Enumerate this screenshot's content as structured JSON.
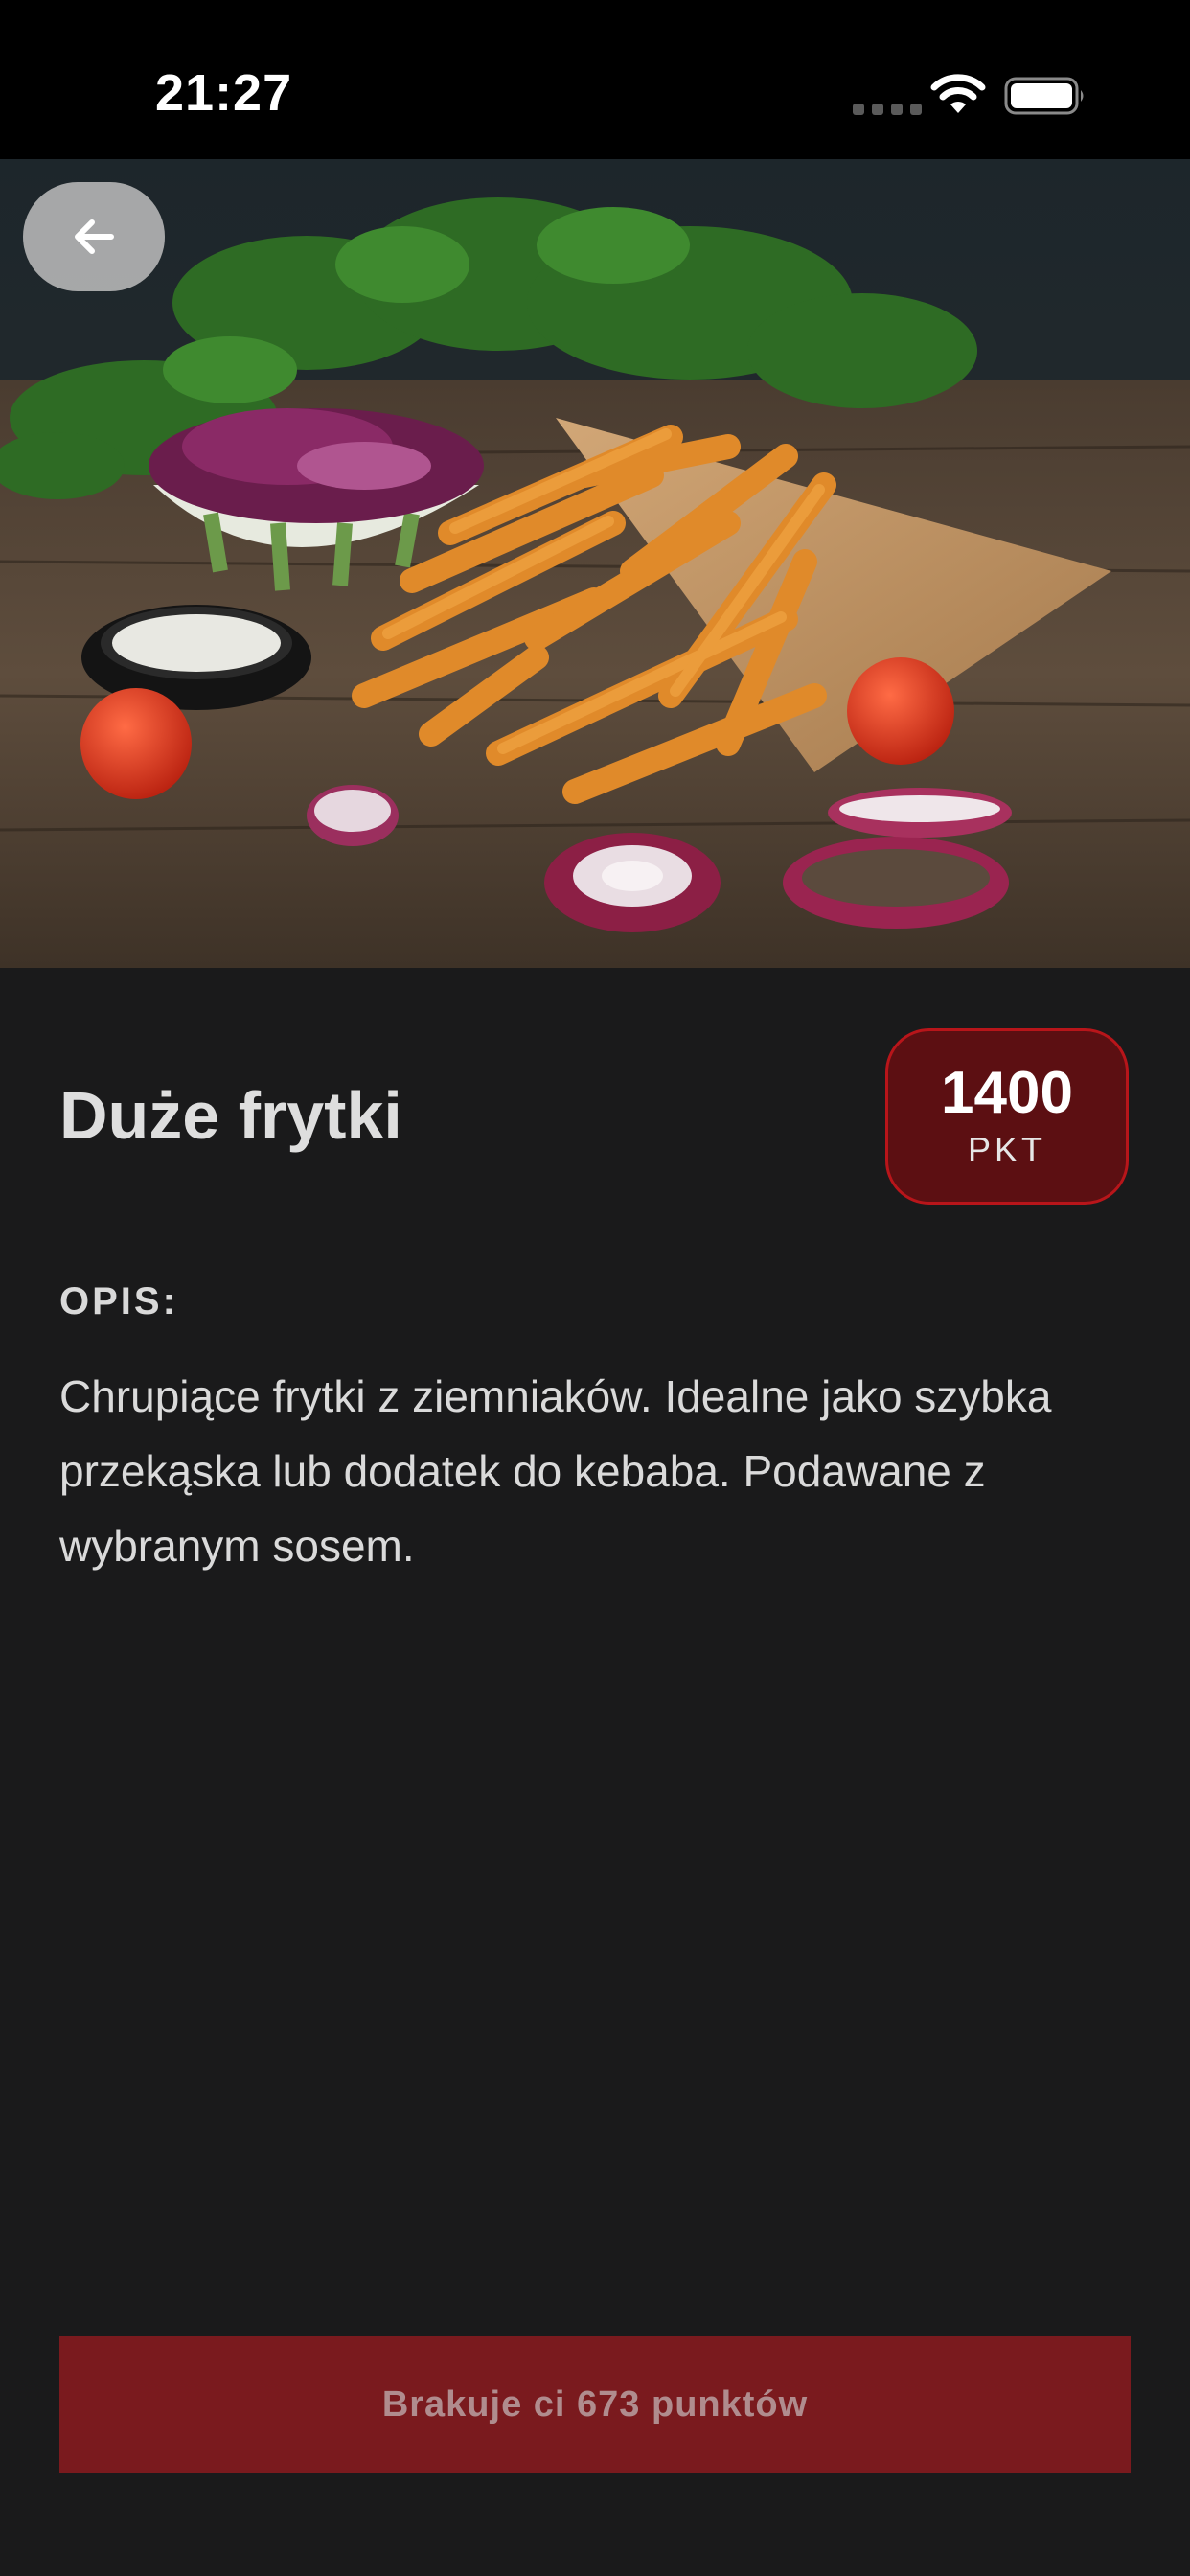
{
  "status_bar": {
    "time": "21:27"
  },
  "navigation": {
    "back_icon": "arrow-left-icon"
  },
  "product": {
    "title": "Duże frytki",
    "price_value": "1400",
    "price_unit": "PKT",
    "description_label": "OPIS:",
    "description": "Chrupiące frytki z ziemniaków. Idealne jako szybka przekąska lub dodatek do kebaba. Podawane z wybranym sosem."
  },
  "action": {
    "button_label": "Brakuje ci 673 punktów"
  },
  "colors": {
    "background": "#1a1a1b",
    "accent": "#7a1a1e",
    "badge_fill": "#5c0f12",
    "badge_border": "#b8151a"
  }
}
